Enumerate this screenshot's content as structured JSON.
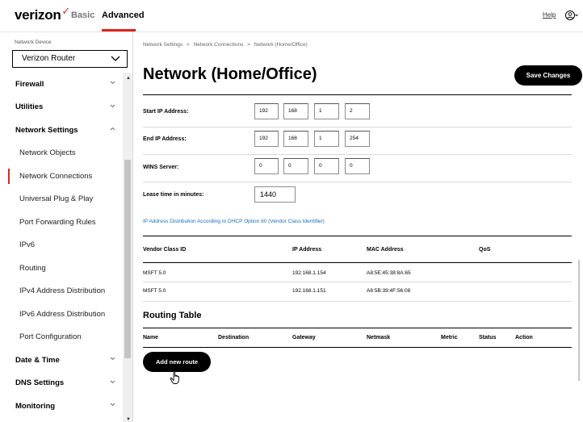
{
  "header": {
    "logo_text": "verizon",
    "logo_check": "✓",
    "tabs": [
      {
        "label": "Basic",
        "active": false
      },
      {
        "label": "Advanced",
        "active": true
      }
    ],
    "help_label": "Help",
    "user_icon": "user-icon",
    "accent_color": "#e0231c"
  },
  "sidebar": {
    "device_label": "Network Device",
    "device_value": "Verizon Router",
    "items": [
      {
        "label": "Firewall",
        "type": "section",
        "expanded": false
      },
      {
        "label": "Utilities",
        "type": "section",
        "expanded": false
      },
      {
        "label": "Network Settings",
        "type": "section",
        "expanded": true
      },
      {
        "label": "Network Objects",
        "type": "sub"
      },
      {
        "label": "Network Connections",
        "type": "sub",
        "active": true
      },
      {
        "label": "Universal Plug & Play",
        "type": "sub"
      },
      {
        "label": "Port Forwarding Rules",
        "type": "sub"
      },
      {
        "label": "IPv6",
        "type": "sub"
      },
      {
        "label": "Routing",
        "type": "sub"
      },
      {
        "label": "IPv4 Address Distribution",
        "type": "sub"
      },
      {
        "label": "IPv6 Address Distribution",
        "type": "sub"
      },
      {
        "label": "Port Configuration",
        "type": "sub"
      },
      {
        "label": "Date & Time",
        "type": "section",
        "expanded": false
      },
      {
        "label": "DNS Settings",
        "type": "section",
        "expanded": false
      },
      {
        "label": "Monitoring",
        "type": "section",
        "expanded": false
      }
    ]
  },
  "main": {
    "breadcrumb": [
      "Network Settings",
      "Network Connections",
      "Network (Home/Office)"
    ],
    "breadcrumb_sep": ">",
    "title": "Network (Home/Office)",
    "save_label": "Save Changes",
    "fields": {
      "start_ip": {
        "label": "Start IP Address:",
        "octets": [
          "192",
          "168",
          "1",
          "2"
        ]
      },
      "end_ip": {
        "label": "End IP Address:",
        "octets": [
          "192",
          "168",
          "1",
          "254"
        ]
      },
      "wins": {
        "label": "WINS Server:",
        "octets": [
          "0",
          "0",
          "0",
          "0"
        ]
      },
      "lease": {
        "label": "Lease time in minutes:",
        "value": "1440"
      }
    },
    "dhcp_link": "IP Address Distribution According to DHCP Option 60 (Vendor Class Identifier)",
    "vendor_table": {
      "headers": [
        "Vendor Class ID",
        "IP Address",
        "MAC Address",
        "QoS"
      ],
      "rows": [
        [
          "MSFT 5.0",
          "192.168.1.154",
          "A8:5E:45:38:8A:65",
          ""
        ],
        [
          "MSFT 5.0",
          "192.168.1.151",
          "A8:5B:39:4F:56:08",
          ""
        ]
      ]
    },
    "routing": {
      "title": "Routing Table",
      "headers": [
        "Name",
        "Destination",
        "Gateway",
        "Netmask",
        "Metric",
        "Status",
        "Action"
      ],
      "add_label": "Add new route"
    }
  }
}
